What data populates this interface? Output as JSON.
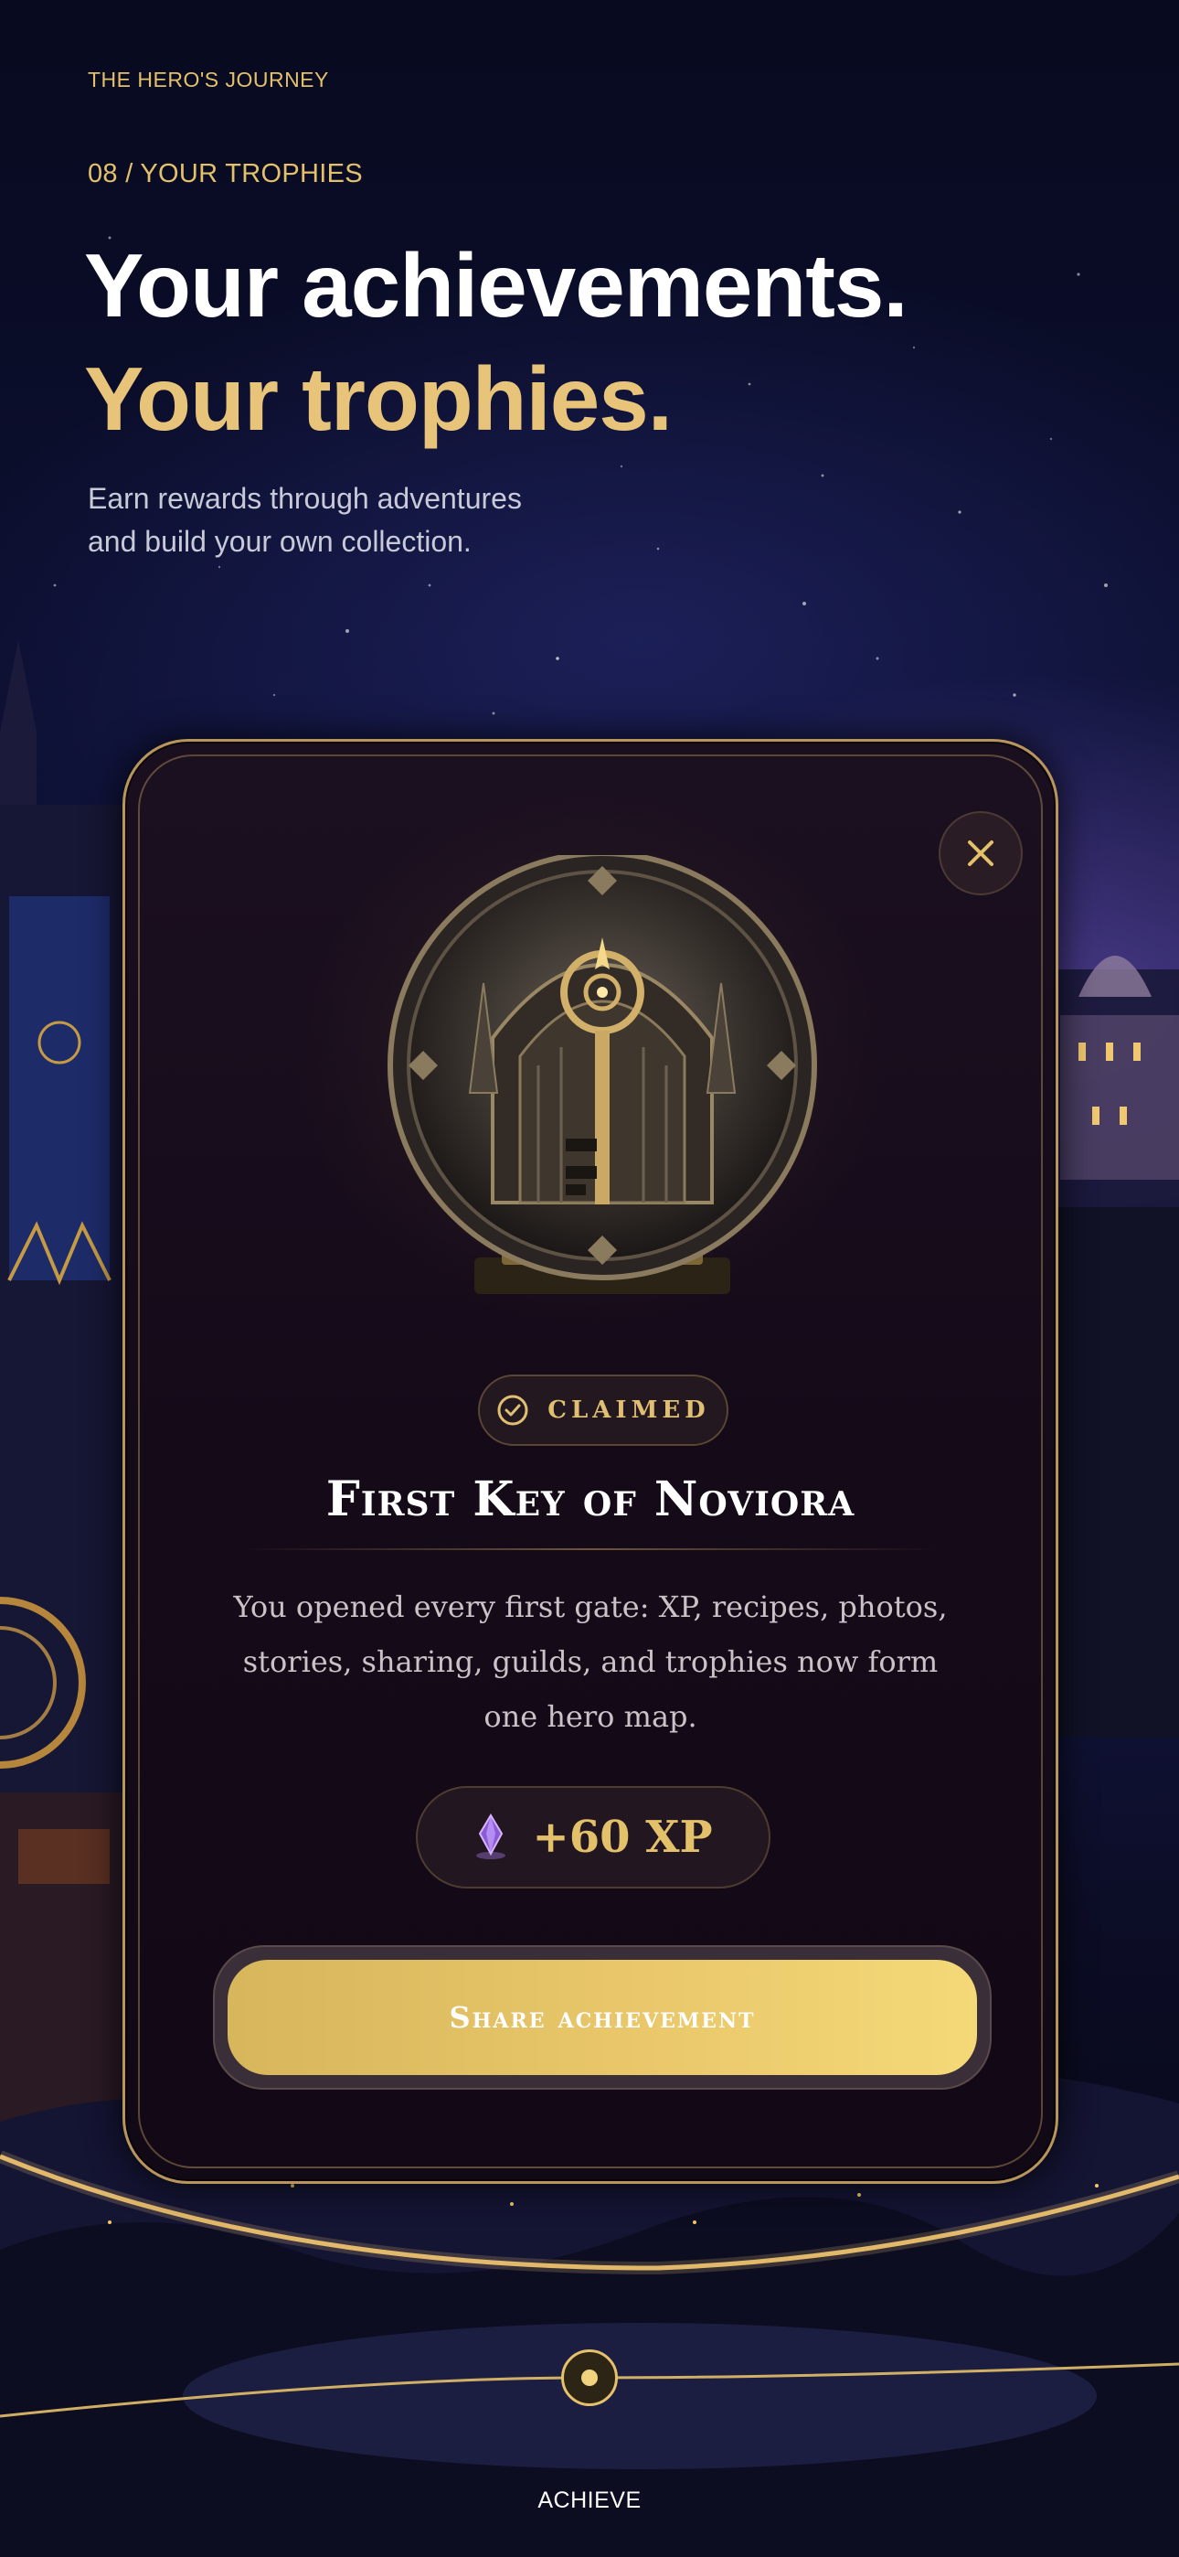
{
  "header": {
    "eyebrow": "THE HERO'S JOURNEY",
    "section_label": "08 / YOUR TROPHIES",
    "headline_line1": "Your achievements.",
    "headline_line2": "Your trophies.",
    "subtitle_line1": "Earn rewards through adventures",
    "subtitle_line2": "and build your own collection."
  },
  "modal": {
    "close_icon": "close-icon",
    "medallion_icon": "key-medallion-icon",
    "status_icon": "check-circle-icon",
    "status_label": "CLAIMED",
    "title": "First Key of Noviora",
    "description": "You opened every first gate: XP, recipes, photos, stories, sharing, guilds, and trophies now form one hero map.",
    "reward_icon": "crystal-icon",
    "reward_label": "+60 XP",
    "share_label": "Share achievement"
  },
  "nav": {
    "node_icon": "journey-node-icon",
    "label": "ACHIEVE"
  },
  "colors": {
    "accent_gold": "#e3c06a",
    "headline_gold": "#e7c47a",
    "card_background": "#150b19",
    "button_gold_start": "#d7b65c",
    "button_gold_end": "#f4d978"
  }
}
